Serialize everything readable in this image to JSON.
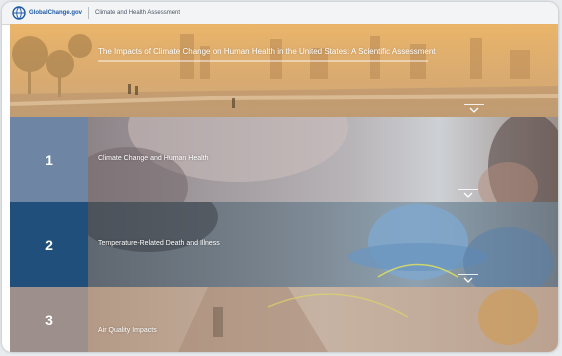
{
  "header": {
    "logo_text": "GlobalChange.gov",
    "breadcrumb": "Climate and Health Assessment"
  },
  "hero": {
    "title": "The Impacts of Climate Change on Human Health in the United States: A Scientific Assessment"
  },
  "sections": [
    {
      "number": "1",
      "title": "Climate Change and Human Health"
    },
    {
      "number": "2",
      "title": "Temperature-Related Death and Illness"
    },
    {
      "number": "3",
      "title": "Air Quality Impacts"
    }
  ],
  "colors": {
    "hero_tint": "#dfa860",
    "section1_panel": "#6e85a3",
    "section2_panel": "#1f4f7a",
    "section3_panel": "#9c8f8c"
  },
  "icons": {
    "logo": "globe-icon",
    "expand": "chevron-down-icon"
  }
}
